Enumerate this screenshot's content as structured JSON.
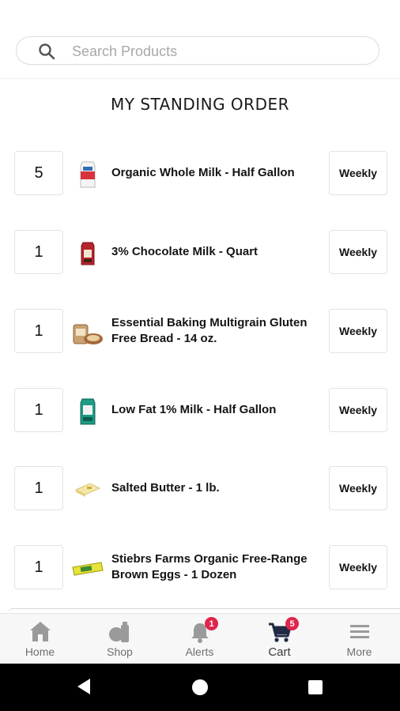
{
  "search": {
    "placeholder": "Search Products",
    "value": ""
  },
  "page_title": "MY STANDING ORDER",
  "items": [
    {
      "qty": "5",
      "name": "Organic Whole Milk - Half Gallon",
      "frequency": "Weekly",
      "icon": "milk-carton-red-icon"
    },
    {
      "qty": "1",
      "name": "3% Chocolate Milk - Quart",
      "frequency": "Weekly",
      "icon": "chocolate-milk-carton-icon"
    },
    {
      "qty": "1",
      "name": "Essential Baking Multigrain Gluten Free Bread - 14 oz.",
      "frequency": "Weekly",
      "icon": "bread-loaf-icon"
    },
    {
      "qty": "1",
      "name": "Low Fat 1% Milk - Half Gallon",
      "frequency": "Weekly",
      "icon": "milk-carton-green-icon"
    },
    {
      "qty": "1",
      "name": "Salted Butter - 1 lb.",
      "frequency": "Weekly",
      "icon": "butter-icon"
    },
    {
      "qty": "1",
      "name": "Stiebrs Farms Organic Free-Range Brown Eggs - 1 Dozen",
      "frequency": "Weekly",
      "icon": "egg-carton-icon"
    }
  ],
  "nav": {
    "home": {
      "label": "Home",
      "icon": "home-icon"
    },
    "shop": {
      "label": "Shop",
      "icon": "shop-bag-icon"
    },
    "alerts": {
      "label": "Alerts",
      "icon": "bell-icon",
      "badge": "1"
    },
    "cart": {
      "label": "Cart",
      "icon": "cart-icon",
      "badge": "5"
    },
    "more": {
      "label": "More",
      "icon": "hamburger-menu-icon"
    }
  },
  "colors": {
    "badge": "#e0244b",
    "nav_icon": "#9a9a9a",
    "cart_icon": "#1f2a44"
  }
}
